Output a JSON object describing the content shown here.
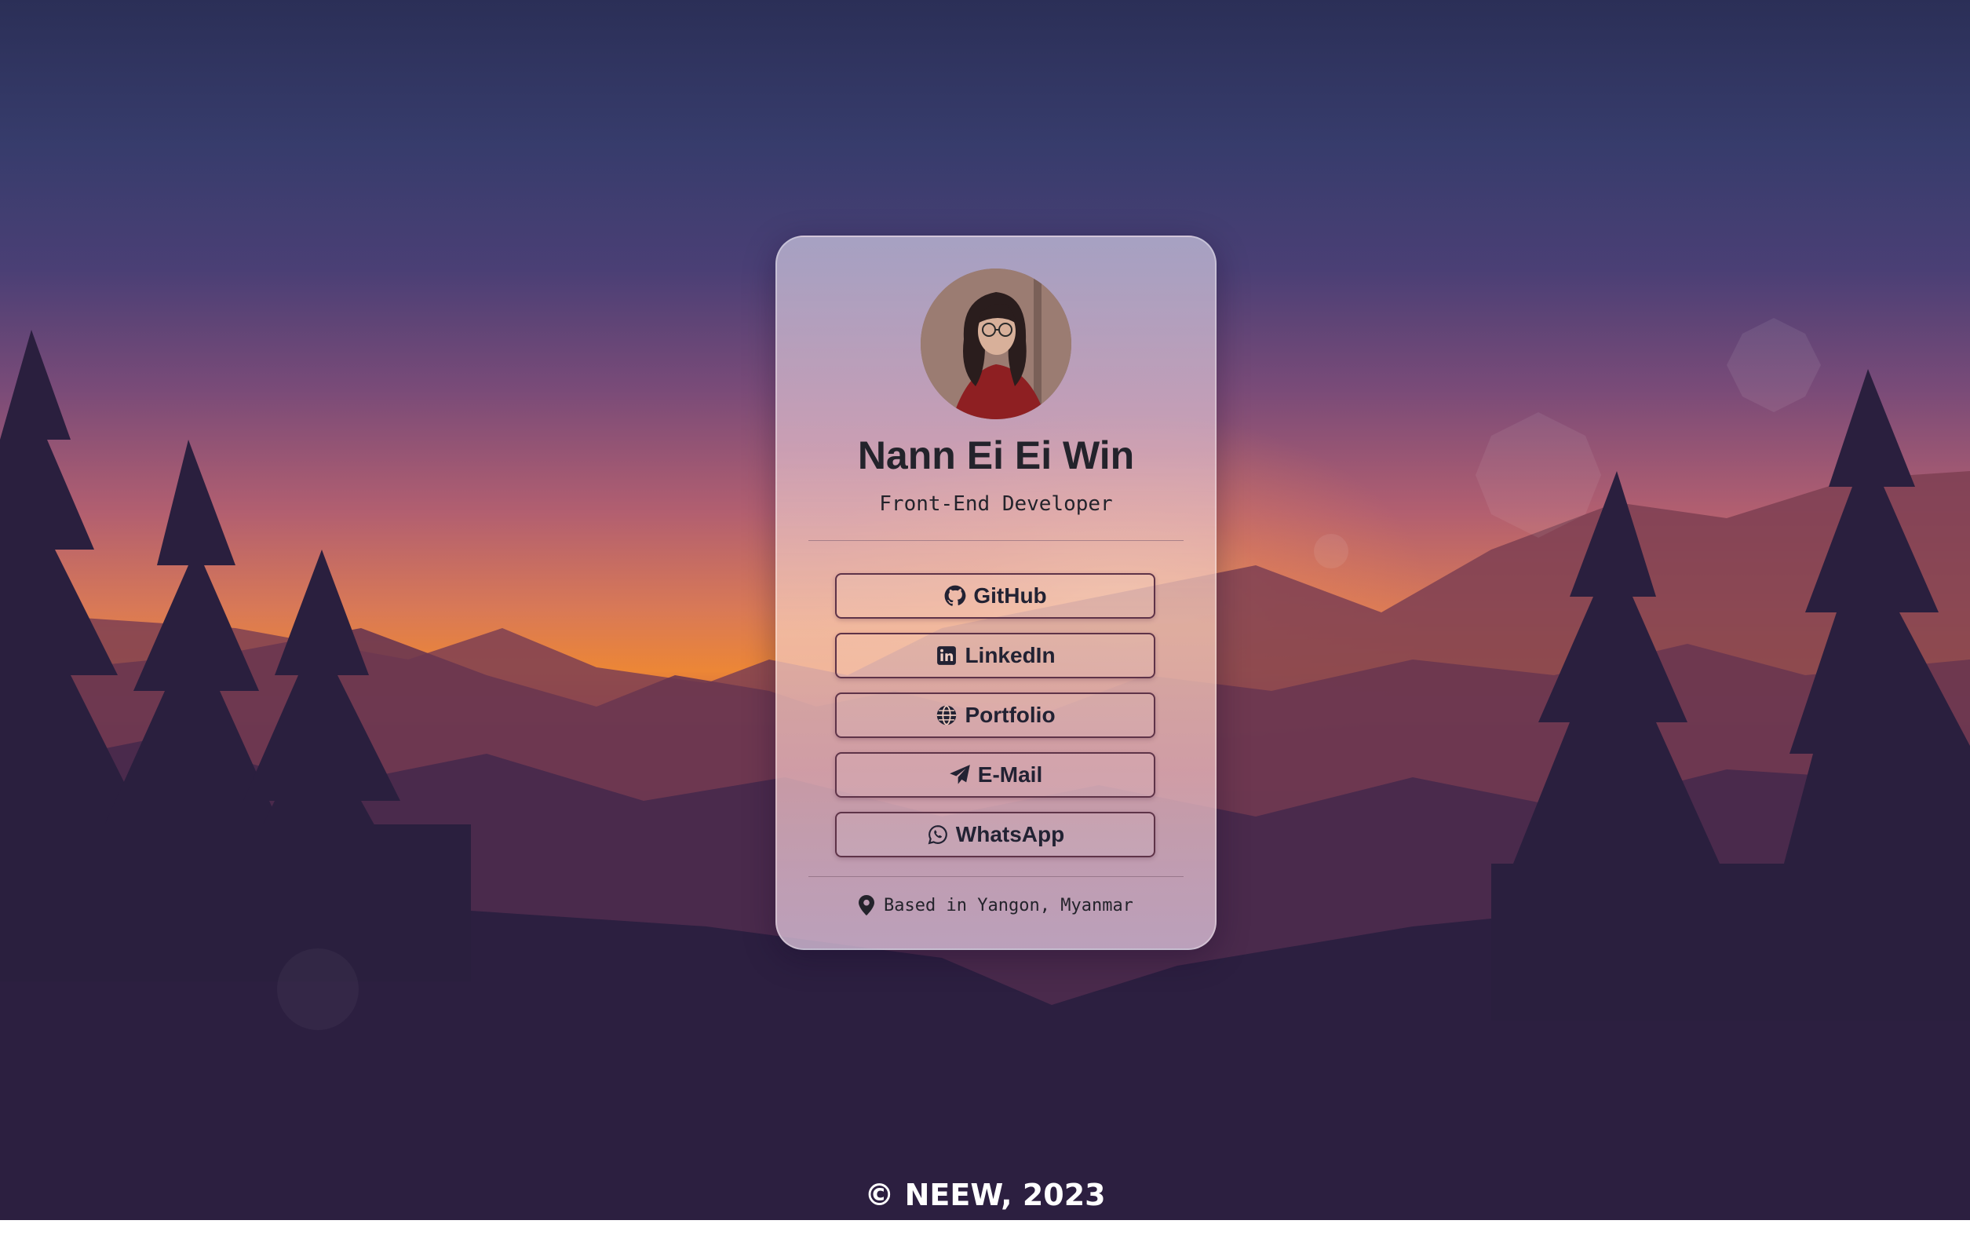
{
  "profile": {
    "name": "Nann Ei Ei Win",
    "role": "Front-End Developer",
    "avatar_icon": "profile-photo"
  },
  "links": [
    {
      "label": "GitHub",
      "icon": "github-icon"
    },
    {
      "label": "LinkedIn",
      "icon": "linkedin-icon"
    },
    {
      "label": "Portfolio",
      "icon": "globe-icon"
    },
    {
      "label": "E-Mail",
      "icon": "paper-plane-icon"
    },
    {
      "label": "WhatsApp",
      "icon": "whatsapp-icon"
    }
  ],
  "location": {
    "text": "Based in Yangon, Myanmar",
    "icon": "map-pin-icon"
  },
  "footer": {
    "text": "© NEEW, 2023"
  },
  "colors": {
    "button_border": "#5e3348",
    "text": "#23232b",
    "footer_text": "#ffffff"
  }
}
